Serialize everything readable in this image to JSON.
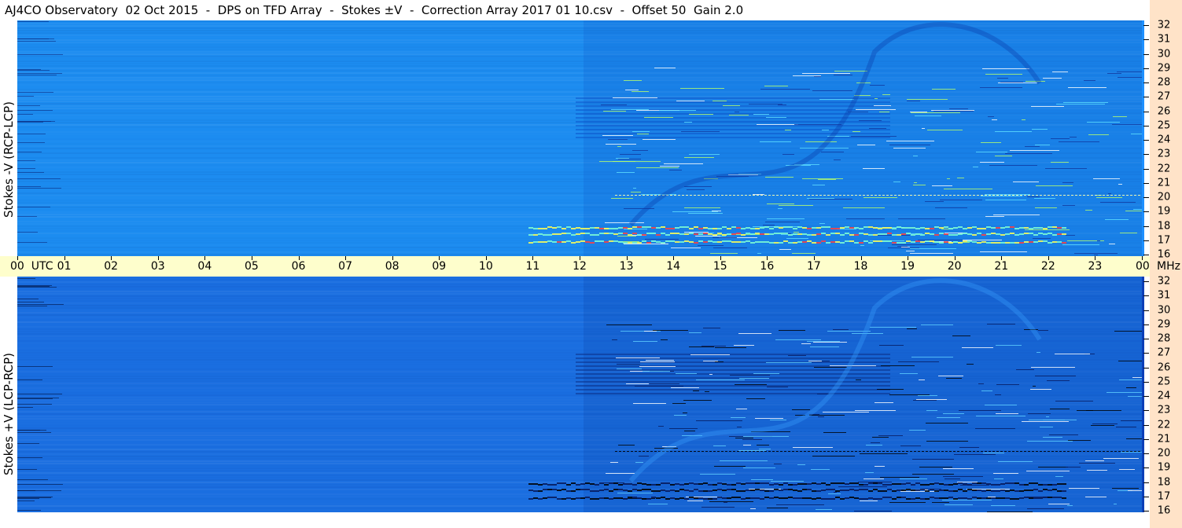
{
  "title": "AJ4CO Observatory  02 Oct 2015  -  DPS on TFD Array  -  Stokes ±V  -  Correction Array 2017 01 10.csv  -  Offset 50  Gain 2.0",
  "panels": [
    {
      "label": "Stokes -V (RCP-LCP)",
      "base_color": "#1c8cf0",
      "scale_color": "#1e90ff"
    },
    {
      "label": "Stokes +V (LCP-RCP)",
      "base_color": "#1a6ee0",
      "scale_color": "#0b3fb8"
    }
  ],
  "time_axis": {
    "labels": [
      "00  UTC",
      "01",
      "02",
      "03",
      "04",
      "05",
      "06",
      "07",
      "08",
      "09",
      "10",
      "11",
      "12",
      "13",
      "14",
      "15",
      "16",
      "17",
      "18",
      "19",
      "20",
      "21",
      "22",
      "23",
      "00"
    ],
    "unit": "MHz"
  },
  "freq_axis": {
    "labels": [
      "32",
      "31",
      "30",
      "29",
      "28",
      "27",
      "26",
      "25",
      "24",
      "23",
      "22",
      "21",
      "20",
      "19",
      "18",
      "17",
      "16"
    ]
  },
  "colors": {
    "background": "#ffffff",
    "timebar": "#fefecc",
    "right_margin": "#ffe3c8"
  },
  "chart_data": {
    "type": "heatmap",
    "title": "AJ4CO Observatory  02 Oct 2015  -  DPS on TFD Array  -  Stokes ±V  -  Correction Array 2017 01 10.csv  -  Offset 50  Gain 2.0",
    "x_range": [
      "00",
      "00"
    ],
    "x_unit": "UTC",
    "y_range": [
      16,
      32
    ],
    "y_unit": "MHz",
    "series": [
      {
        "name": "Stokes -V (RCP-LCP)"
      },
      {
        "name": "Stokes +V (LCP-RCP)"
      }
    ]
  }
}
